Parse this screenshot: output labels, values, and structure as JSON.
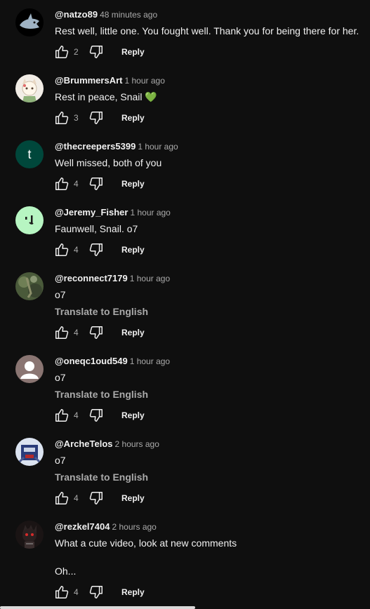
{
  "comments": [
    {
      "author": "@natzo89",
      "time": "48 minutes ago",
      "text": "Rest well, little one. You fought well. Thank you for being there for her.",
      "likes": "2",
      "reply": "Reply",
      "translate": "",
      "avatar": {
        "kind": "shark",
        "bg": "#000000"
      }
    },
    {
      "author": "@BrummersArt",
      "time": "1 hour ago",
      "text": "Rest in peace, Snail 💚",
      "likes": "3",
      "reply": "Reply",
      "translate": "",
      "avatar": {
        "kind": "drawing",
        "bg": "#f2ede6"
      }
    },
    {
      "author": "@thecreepers5399",
      "time": "1 hour ago",
      "text": "Well missed, both of you",
      "likes": "4",
      "reply": "Reply",
      "translate": "",
      "avatar": {
        "kind": "letter",
        "letter": "t",
        "bg": "#00473b"
      }
    },
    {
      "author": "@Jeremy_Fisher",
      "time": "1 hour ago",
      "text": "Faunwell, Snail. o7",
      "likes": "4",
      "reply": "Reply",
      "translate": "",
      "avatar": {
        "kind": "face",
        "bg": "#b7f5c2"
      }
    },
    {
      "author": "@reconnect7179",
      "time": "1 hour ago",
      "text": "o7",
      "likes": "4",
      "reply": "Reply",
      "translate": "Translate to English",
      "avatar": {
        "kind": "photo",
        "bg": "#4a5a3a"
      }
    },
    {
      "author": "@oneqc1oud549",
      "time": "1 hour ago",
      "text": "o7",
      "likes": "4",
      "reply": "Reply",
      "translate": "Translate to English",
      "avatar": {
        "kind": "default",
        "bg": "#8a7572"
      }
    },
    {
      "author": "@ArcheTelos",
      "time": "2 hours ago",
      "text": "o7",
      "likes": "4",
      "reply": "Reply",
      "translate": "Translate to English",
      "avatar": {
        "kind": "robot",
        "bg": "#2a3c7a"
      }
    },
    {
      "author": "@rezkel7404",
      "time": "2 hours ago",
      "text": "What a cute video, look at new comments\n\nOh...",
      "likes": "4",
      "reply": "Reply",
      "translate": "",
      "avatar": {
        "kind": "dark",
        "bg": "#1a1414"
      }
    }
  ]
}
